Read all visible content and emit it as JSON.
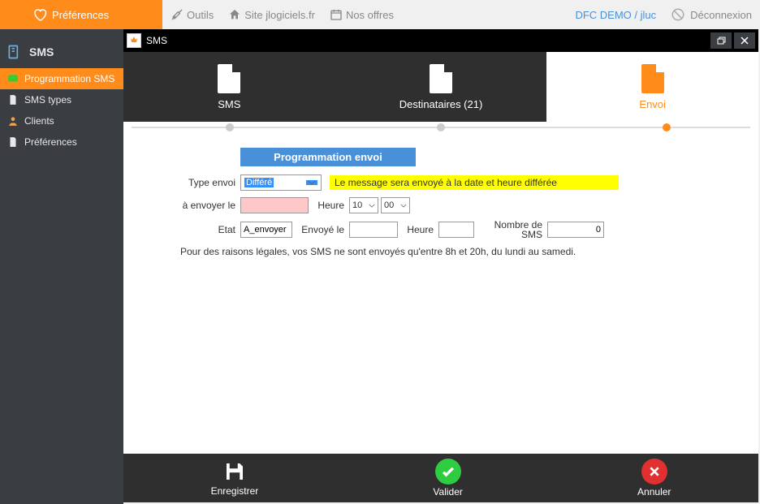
{
  "topbar": {
    "preferences": "Préférences",
    "tools": "Outils",
    "site": "Site jlogiciels.fr",
    "offers": "Nos offres",
    "demo": "DFC DEMO / jluc",
    "logout": "Déconnexion"
  },
  "sidebar": {
    "header": "SMS",
    "items": [
      {
        "label": "Programmation SMS",
        "active": true
      },
      {
        "label": "SMS types",
        "active": false
      },
      {
        "label": "Clients",
        "active": false
      },
      {
        "label": "Préférences",
        "active": false
      }
    ]
  },
  "window": {
    "title": "SMS"
  },
  "tabs": {
    "sms": "SMS",
    "dest": "Destinataires (21)",
    "envoi": "Envoi"
  },
  "form": {
    "section_title": "Programmation envoi",
    "type_label": "Type envoi",
    "type_value": "Différé",
    "hint": "Le message sera envoyé à la date et heure différée",
    "send_on_label": "à envoyer le",
    "send_on_value": "",
    "hour_label": "Heure",
    "hour_h": "10",
    "hour_m": "00",
    "etat_label": "Etat",
    "etat_value": "A_envoyer",
    "envoye_label": "Envoyé le",
    "envoye_value": "",
    "heure2_label": "Heure",
    "heure2_value": "",
    "nbsms_label": "Nombre de SMS",
    "nbsms_value": "0",
    "legal": "Pour des raisons légales, vos SMS ne sont envoyés qu'entre 8h et 20h, du lundi au samedi."
  },
  "actions": {
    "save": "Enregistrer",
    "validate": "Valider",
    "cancel": "Annuler"
  }
}
